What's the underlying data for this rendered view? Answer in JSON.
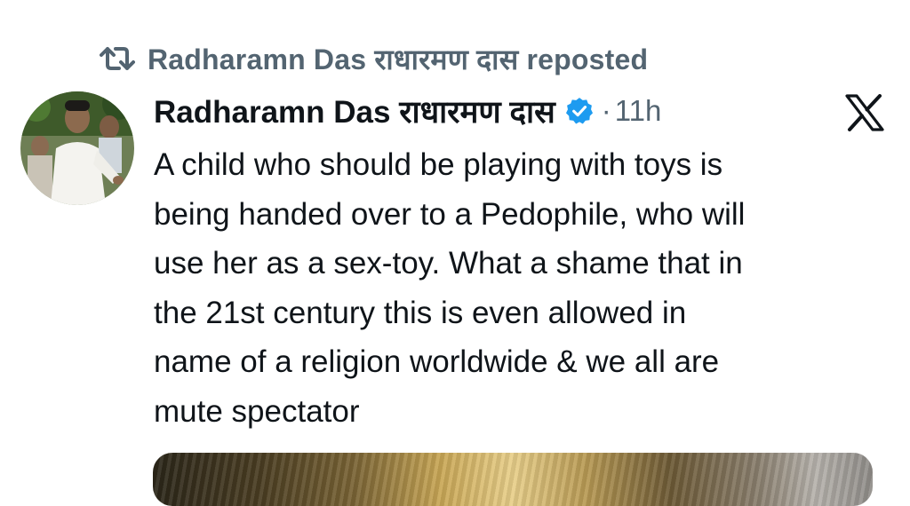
{
  "repost": {
    "icon": "repost-icon",
    "label": "Radharamn Das राधारमण दास reposted"
  },
  "tweet": {
    "author": {
      "name": "Radharamn Das राधारमण दास",
      "verified_icon": "verified-badge-icon",
      "avatar_icon": "avatar-photo"
    },
    "dot": "·",
    "timestamp": "11h",
    "platform_icon": "x-logo-icon",
    "body_lines": [
      "A child who should be playing with toys is",
      "being handed over to a Pedophile, who will",
      "use her as a sex-toy. What a shame that in",
      "the 21st century this is even allowed in",
      "name of a religion worldwide & we all are",
      "mute spectator"
    ]
  },
  "colors": {
    "text_primary": "#0f1419",
    "text_secondary": "#536471",
    "verified_blue": "#1d9bf0",
    "background": "#ffffff"
  }
}
